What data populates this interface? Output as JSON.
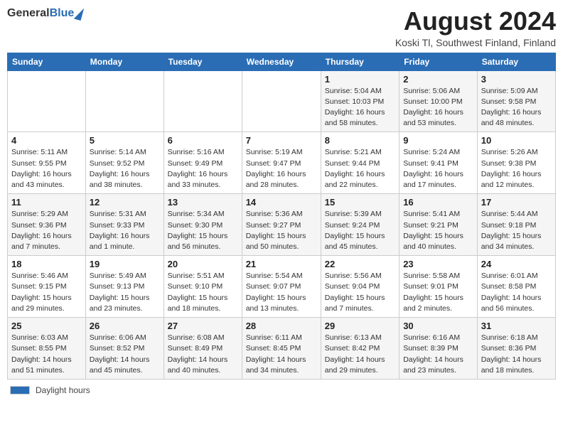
{
  "header": {
    "logo_general": "General",
    "logo_blue": "Blue",
    "month_title": "August 2024",
    "location": "Koski Tl, Southwest Finland, Finland"
  },
  "days_of_week": [
    "Sunday",
    "Monday",
    "Tuesday",
    "Wednesday",
    "Thursday",
    "Friday",
    "Saturday"
  ],
  "legend": {
    "label": "Daylight hours"
  },
  "weeks": [
    [
      {
        "day": "",
        "content": ""
      },
      {
        "day": "",
        "content": ""
      },
      {
        "day": "",
        "content": ""
      },
      {
        "day": "",
        "content": ""
      },
      {
        "day": "1",
        "content": "Sunrise: 5:04 AM\nSunset: 10:03 PM\nDaylight: 16 hours and 58 minutes."
      },
      {
        "day": "2",
        "content": "Sunrise: 5:06 AM\nSunset: 10:00 PM\nDaylight: 16 hours and 53 minutes."
      },
      {
        "day": "3",
        "content": "Sunrise: 5:09 AM\nSunset: 9:58 PM\nDaylight: 16 hours and 48 minutes."
      }
    ],
    [
      {
        "day": "4",
        "content": "Sunrise: 5:11 AM\nSunset: 9:55 PM\nDaylight: 16 hours and 43 minutes."
      },
      {
        "day": "5",
        "content": "Sunrise: 5:14 AM\nSunset: 9:52 PM\nDaylight: 16 hours and 38 minutes."
      },
      {
        "day": "6",
        "content": "Sunrise: 5:16 AM\nSunset: 9:49 PM\nDaylight: 16 hours and 33 minutes."
      },
      {
        "day": "7",
        "content": "Sunrise: 5:19 AM\nSunset: 9:47 PM\nDaylight: 16 hours and 28 minutes."
      },
      {
        "day": "8",
        "content": "Sunrise: 5:21 AM\nSunset: 9:44 PM\nDaylight: 16 hours and 22 minutes."
      },
      {
        "day": "9",
        "content": "Sunrise: 5:24 AM\nSunset: 9:41 PM\nDaylight: 16 hours and 17 minutes."
      },
      {
        "day": "10",
        "content": "Sunrise: 5:26 AM\nSunset: 9:38 PM\nDaylight: 16 hours and 12 minutes."
      }
    ],
    [
      {
        "day": "11",
        "content": "Sunrise: 5:29 AM\nSunset: 9:36 PM\nDaylight: 16 hours and 7 minutes."
      },
      {
        "day": "12",
        "content": "Sunrise: 5:31 AM\nSunset: 9:33 PM\nDaylight: 16 hours and 1 minute."
      },
      {
        "day": "13",
        "content": "Sunrise: 5:34 AM\nSunset: 9:30 PM\nDaylight: 15 hours and 56 minutes."
      },
      {
        "day": "14",
        "content": "Sunrise: 5:36 AM\nSunset: 9:27 PM\nDaylight: 15 hours and 50 minutes."
      },
      {
        "day": "15",
        "content": "Sunrise: 5:39 AM\nSunset: 9:24 PM\nDaylight: 15 hours and 45 minutes."
      },
      {
        "day": "16",
        "content": "Sunrise: 5:41 AM\nSunset: 9:21 PM\nDaylight: 15 hours and 40 minutes."
      },
      {
        "day": "17",
        "content": "Sunrise: 5:44 AM\nSunset: 9:18 PM\nDaylight: 15 hours and 34 minutes."
      }
    ],
    [
      {
        "day": "18",
        "content": "Sunrise: 5:46 AM\nSunset: 9:15 PM\nDaylight: 15 hours and 29 minutes."
      },
      {
        "day": "19",
        "content": "Sunrise: 5:49 AM\nSunset: 9:13 PM\nDaylight: 15 hours and 23 minutes."
      },
      {
        "day": "20",
        "content": "Sunrise: 5:51 AM\nSunset: 9:10 PM\nDaylight: 15 hours and 18 minutes."
      },
      {
        "day": "21",
        "content": "Sunrise: 5:54 AM\nSunset: 9:07 PM\nDaylight: 15 hours and 13 minutes."
      },
      {
        "day": "22",
        "content": "Sunrise: 5:56 AM\nSunset: 9:04 PM\nDaylight: 15 hours and 7 minutes."
      },
      {
        "day": "23",
        "content": "Sunrise: 5:58 AM\nSunset: 9:01 PM\nDaylight: 15 hours and 2 minutes."
      },
      {
        "day": "24",
        "content": "Sunrise: 6:01 AM\nSunset: 8:58 PM\nDaylight: 14 hours and 56 minutes."
      }
    ],
    [
      {
        "day": "25",
        "content": "Sunrise: 6:03 AM\nSunset: 8:55 PM\nDaylight: 14 hours and 51 minutes."
      },
      {
        "day": "26",
        "content": "Sunrise: 6:06 AM\nSunset: 8:52 PM\nDaylight: 14 hours and 45 minutes."
      },
      {
        "day": "27",
        "content": "Sunrise: 6:08 AM\nSunset: 8:49 PM\nDaylight: 14 hours and 40 minutes."
      },
      {
        "day": "28",
        "content": "Sunrise: 6:11 AM\nSunset: 8:45 PM\nDaylight: 14 hours and 34 minutes."
      },
      {
        "day": "29",
        "content": "Sunrise: 6:13 AM\nSunset: 8:42 PM\nDaylight: 14 hours and 29 minutes."
      },
      {
        "day": "30",
        "content": "Sunrise: 6:16 AM\nSunset: 8:39 PM\nDaylight: 14 hours and 23 minutes."
      },
      {
        "day": "31",
        "content": "Sunrise: 6:18 AM\nSunset: 8:36 PM\nDaylight: 14 hours and 18 minutes."
      }
    ]
  ]
}
